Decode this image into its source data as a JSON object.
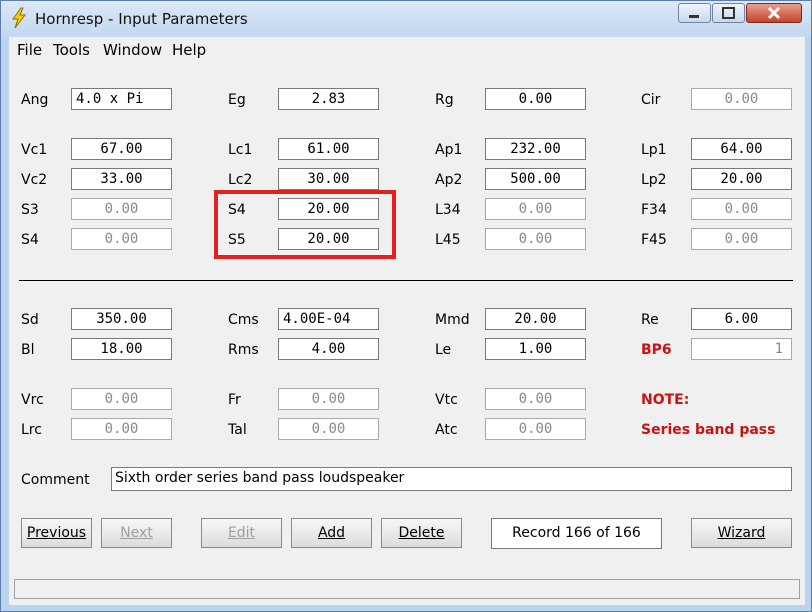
{
  "window": {
    "title": "Hornresp - Input Parameters"
  },
  "menu": [
    "File",
    "Tools",
    "Window",
    "Help"
  ],
  "rows1": [
    {
      "labels": [
        "Ang",
        "Eg",
        "Rg",
        "Cir"
      ],
      "values": [
        "4.0 x Pi",
        "2.83",
        "0.00",
        "0.00"
      ]
    }
  ],
  "rows2": [
    {
      "labels": [
        "Vc1",
        "Lc1",
        "Ap1",
        "Lp1"
      ],
      "values": [
        "67.00",
        "61.00",
        "232.00",
        "64.00"
      ]
    },
    {
      "labels": [
        "Vc2",
        "Lc2",
        "Ap2",
        "Lp2"
      ],
      "values": [
        "33.00",
        "30.00",
        "500.00",
        "20.00"
      ]
    },
    {
      "labels": [
        "S3",
        "S4",
        "L34",
        "F34"
      ],
      "values": [
        "0.00",
        "20.00",
        "0.00",
        "0.00"
      ]
    },
    {
      "labels": [
        "S4",
        "S5",
        "L45",
        "F45"
      ],
      "values": [
        "0.00",
        "20.00",
        "0.00",
        "0.00"
      ]
    }
  ],
  "rows3": [
    {
      "labels": [
        "Sd",
        "Cms",
        "Mmd",
        "Re"
      ],
      "values": [
        "350.00",
        "4.00E-04",
        "20.00",
        "6.00"
      ]
    },
    {
      "labels": [
        "Bl",
        "Rms",
        "Le",
        "BP6"
      ],
      "values": [
        "18.00",
        "4.00",
        "1.00",
        "1"
      ]
    }
  ],
  "rows4": [
    {
      "labels": [
        "Vrc",
        "Fr",
        "Vtc",
        "NOTE:"
      ],
      "values": [
        "0.00",
        "0.00",
        "0.00"
      ]
    },
    {
      "labels": [
        "Lrc",
        "Tal",
        "Atc",
        "Series band pass"
      ],
      "values": [
        "0.00",
        "0.00",
        "0.00"
      ]
    }
  ],
  "comment": {
    "label": "Comment",
    "value": "Sixth order series band pass loudspeaker"
  },
  "buttons": {
    "previous": "Previous",
    "next": "Next",
    "edit": "Edit",
    "add": "Add",
    "delete": "Delete",
    "wizard": "Wizard"
  },
  "record": "Record 166 of 166",
  "colors": {
    "accent_red": "#cc1111",
    "highlight": "#e32020"
  }
}
